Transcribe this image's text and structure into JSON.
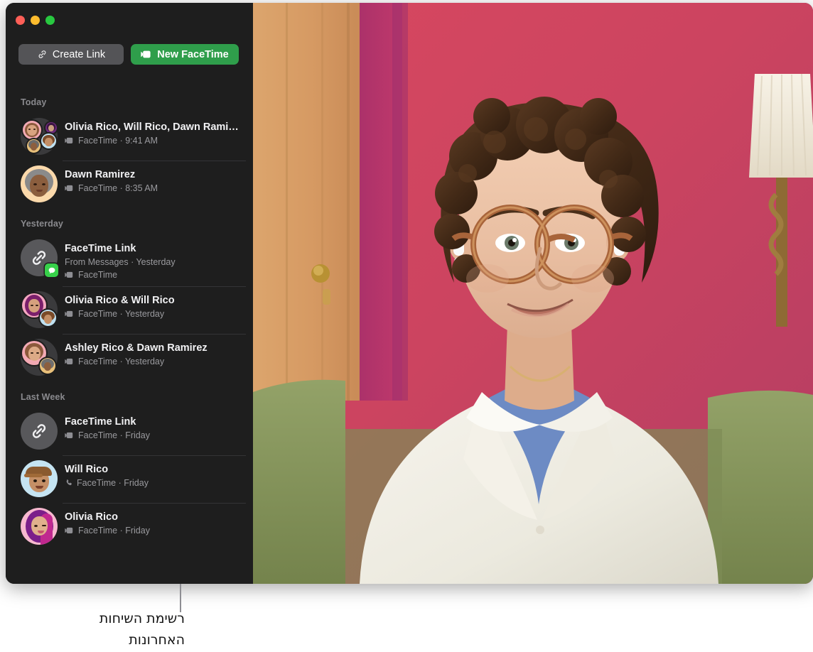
{
  "window": {
    "traffic_lights": [
      {
        "name": "close",
        "color": "#ff5f57"
      },
      {
        "name": "minimize",
        "color": "#febc2e"
      },
      {
        "name": "zoom",
        "color": "#28c840"
      }
    ]
  },
  "toolbar": {
    "create_link_label": "Create Link",
    "create_link_icon": "link-icon",
    "new_facetime_label": "New FaceTime",
    "new_facetime_icon": "video-camera-icon",
    "accent_green": "#2f9e4b",
    "button_grey": "#545457"
  },
  "sections": [
    {
      "header": "Today",
      "rows": [
        {
          "title": "Olivia Rico, Will Rico, Dawn Rami…",
          "subtitle": "FaceTime · 9:41 AM",
          "call_type_icon": "video-camera-icon",
          "avatar": "group-four-memoji",
          "source_line": null,
          "badge": null
        },
        {
          "title": "Dawn Ramirez",
          "subtitle": "FaceTime · 8:35 AM",
          "call_type_icon": "video-camera-icon",
          "avatar": "memoji-dawn",
          "source_line": null,
          "badge": null
        }
      ]
    },
    {
      "header": "Yesterday",
      "rows": [
        {
          "title": "FaceTime Link",
          "source_line": "From Messages · Yesterday",
          "subtitle": "FaceTime",
          "call_type_icon": "video-camera-icon",
          "avatar": "link-icon",
          "badge": "messages-app-badge"
        },
        {
          "title": "Olivia Rico & Will Rico",
          "subtitle": "FaceTime · Yesterday",
          "call_type_icon": "video-camera-icon",
          "avatar": "group-two-olivia-will",
          "source_line": null,
          "badge": null
        },
        {
          "title": "Ashley Rico & Dawn Ramirez",
          "subtitle": "FaceTime · Yesterday",
          "call_type_icon": "video-camera-icon",
          "avatar": "group-two-ashley-dawn",
          "source_line": null,
          "badge": null
        }
      ]
    },
    {
      "header": "Last Week",
      "rows": [
        {
          "title": "FaceTime Link",
          "subtitle": "FaceTime · Friday",
          "call_type_icon": "video-camera-icon",
          "avatar": "link-icon",
          "source_line": null,
          "badge": null
        },
        {
          "title": "Will Rico",
          "subtitle": "FaceTime · Friday",
          "call_type_icon": "phone-icon",
          "avatar": "memoji-will",
          "source_line": null,
          "badge": null
        },
        {
          "title": "Olivia Rico",
          "subtitle": "FaceTime · Friday",
          "call_type_icon": "video-camera-icon",
          "avatar": "memoji-olivia",
          "source_line": null,
          "badge": null
        }
      ]
    }
  ],
  "video": {
    "description": "Woman with short curly brown hair, tortoiseshell glasses and AirPods, wearing a white shirt over a blue t-shirt, seated on a green sofa in front of a pink wall beside a wooden door and a lamp.",
    "wall_color": "#c9485f",
    "door_color": "#d5a06a",
    "sofa_color": "#8d9c63"
  },
  "caption": {
    "line1": "רשימת השיחות",
    "line2": "האחרונות"
  }
}
